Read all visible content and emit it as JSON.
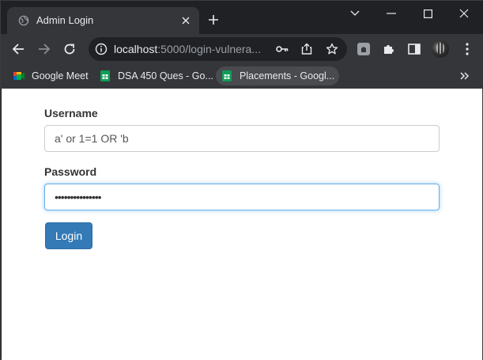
{
  "tab": {
    "title": "Admin Login",
    "new_tab_symbol": "+"
  },
  "address_bar": {
    "host": "localhost",
    "path": ":5000/login-vulnera..."
  },
  "bookmarks": [
    {
      "label": "Google Meet",
      "icon": "google-meet-icon"
    },
    {
      "label": "DSA 450 Ques - Go...",
      "icon": "google-sheets-icon"
    },
    {
      "label": "Placements - Googl...",
      "icon": "google-sheets-icon"
    }
  ],
  "form": {
    "username_label": "Username",
    "username_value": "a' or 1=1 OR 'b",
    "password_label": "Password",
    "password_value": "•••••••••••••••",
    "login_label": "Login"
  },
  "colors": {
    "accent": "#337ab7",
    "focus_border": "#66afe9",
    "chrome_dark": "#202124",
    "chrome_mid": "#35363a"
  }
}
